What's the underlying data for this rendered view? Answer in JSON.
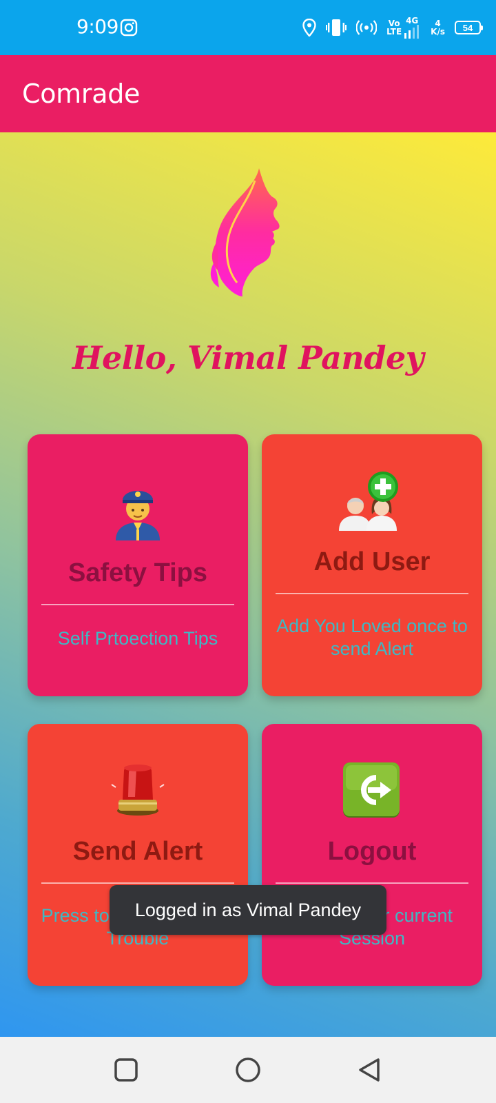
{
  "status_bar": {
    "time": "9:09",
    "network_top": "Vo",
    "network_bottom": "LTE",
    "network_gen": "4G",
    "speed_value": "4",
    "speed_unit": "K/s",
    "battery": "54"
  },
  "app_bar": {
    "title": "Comrade"
  },
  "greeting": "Hello, Vimal Pandey",
  "cards": {
    "safety": {
      "title": "Safety Tips",
      "subtitle": "Self Prtoection Tips"
    },
    "add_user": {
      "title": "Add User",
      "subtitle": "Add You Loved once to send Alert"
    },
    "send_alert": {
      "title": "Send Alert",
      "subtitle": "Press to Send Alert if in Trouble"
    },
    "logout": {
      "title": "Logout",
      "subtitle": "Logout your current Session"
    }
  },
  "toast": "Logged in as Vimal Pandey",
  "colors": {
    "status_bar": "#0ba5ec",
    "app_bar": "#ea1e63",
    "card_pink": "#ea1e63",
    "card_red": "#f44335",
    "greeting": "#e0135f"
  },
  "icons": [
    "instagram-icon",
    "location-icon",
    "vibrate-icon",
    "hotspot-icon",
    "signal-icon",
    "battery-icon",
    "woman-face-logo",
    "police-officer-icon",
    "add-user-icon",
    "siren-icon",
    "logout-icon",
    "recents-icon",
    "home-icon",
    "back-icon"
  ]
}
